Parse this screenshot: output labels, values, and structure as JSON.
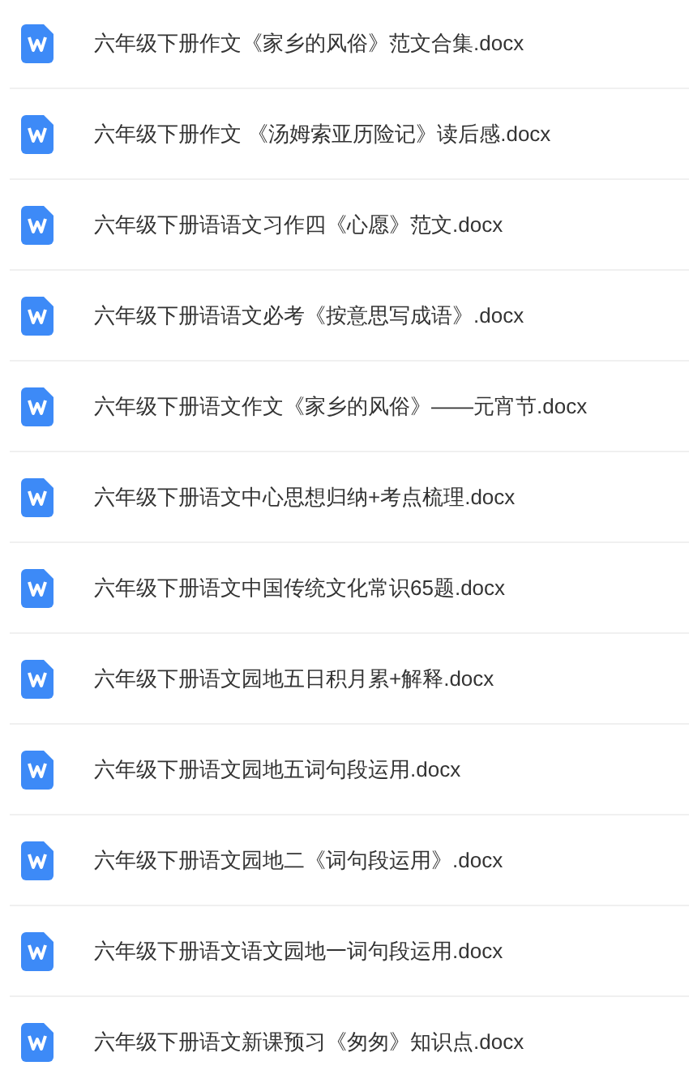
{
  "files": [
    {
      "name": "六年级下册作文《家乡的风俗》范文合集.docx"
    },
    {
      "name": "六年级下册作文 《汤姆索亚历险记》读后感.docx"
    },
    {
      "name": "六年级下册语语文习作四《心愿》范文.docx"
    },
    {
      "name": "六年级下册语语文必考《按意思写成语》.docx"
    },
    {
      "name": "六年级下册语文作文《家乡的风俗》——元宵节.docx"
    },
    {
      "name": "六年级下册语文中心思想归纳+考点梳理.docx"
    },
    {
      "name": "六年级下册语文中国传统文化常识65题.docx"
    },
    {
      "name": "六年级下册语文园地五日积月累+解释.docx"
    },
    {
      "name": "六年级下册语文园地五词句段运用.docx"
    },
    {
      "name": "六年级下册语文园地二《词句段运用》.docx"
    },
    {
      "name": "六年级下册语文语文园地一词句段运用.docx"
    },
    {
      "name": "六年级下册语文新课预习《匆匆》知识点.docx"
    }
  ]
}
